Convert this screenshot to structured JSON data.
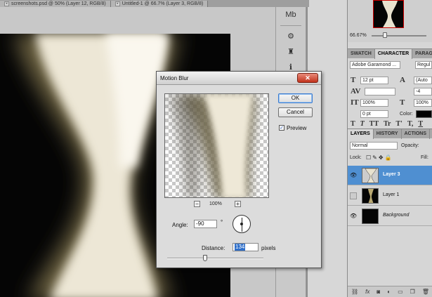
{
  "document_tabs": [
    {
      "label": "screenshots.psd @ 50% (Layer 12, RGB/8)"
    },
    {
      "label": "Untitled-1 @ 66.7% (Layer 3, RGB/8)"
    }
  ],
  "navigator": {
    "zoom": "66.67%"
  },
  "character_panel": {
    "tabs": [
      "SWATCH",
      "CHARACTER",
      "PARAG"
    ],
    "font_family": "Adobe Garamond ...",
    "font_style": "Regul",
    "font_size": "12 pt",
    "leading": "(Auto",
    "tracking": "-4",
    "vertical_scale": "100%",
    "horizontal_scale": "100%",
    "baseline_shift": "0 pt",
    "color_label": "Color:",
    "style_buttons": [
      "T",
      "T",
      "TT",
      "Tr",
      "T'",
      "T,",
      "T",
      "T"
    ]
  },
  "layers_panel": {
    "tabs": [
      "LAYERS",
      "HISTORY",
      "ACTIONS"
    ],
    "blend_mode": "Normal",
    "opacity_label": "Opacity:",
    "lock_label": "Lock:",
    "fill_label": "Fill:",
    "layers": [
      {
        "name": "Layer 3",
        "visible": true,
        "selected": true
      },
      {
        "name": "Layer 1",
        "visible": false,
        "selected": false
      },
      {
        "name": "Background",
        "visible": true,
        "selected": false
      }
    ],
    "bottom_icons": [
      "link-icon",
      "fx-icon",
      "mask-icon",
      "adjustment-icon",
      "folder-icon",
      "new-layer-icon",
      "trash-icon"
    ]
  },
  "dialog": {
    "title": "Motion Blur",
    "close_glyph": "✕",
    "ok_label": "OK",
    "cancel_label": "Cancel",
    "preview_label": "Preview",
    "preview_checked": true,
    "zoom_out_label": "−",
    "zoom_in_label": "+",
    "zoom_level": "100%",
    "angle_label": "Angle:",
    "angle_value": "-90",
    "degree_sign": "°",
    "distance_label": "Distance:",
    "distance_value": "134",
    "pixels_label": "pixels"
  }
}
